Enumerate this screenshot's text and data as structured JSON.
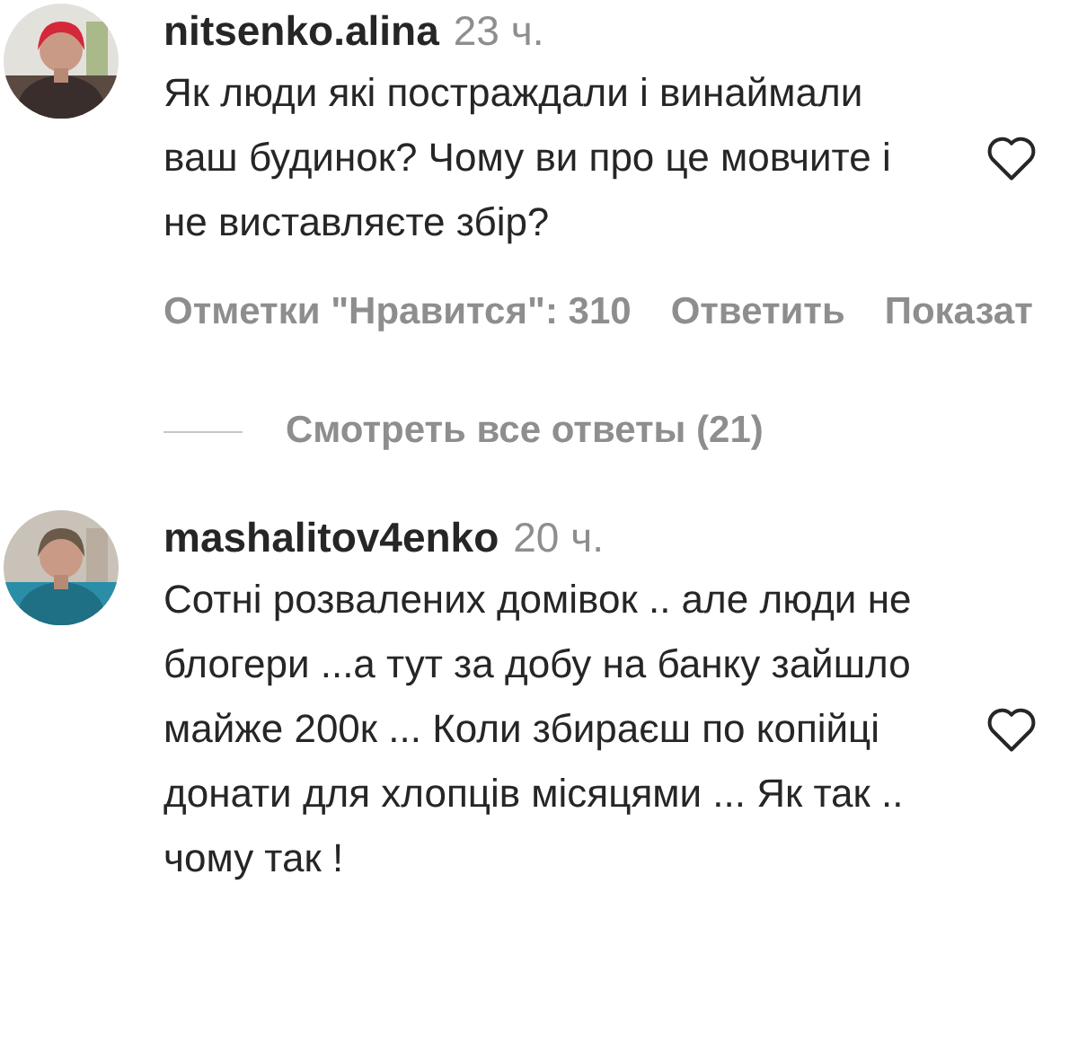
{
  "comments": [
    {
      "username": "nitsenko.alina",
      "time": "23 ч.",
      "text": "Як люди які постраждали і винаймали ваш будинок? Чому ви про це мовчите і не виставляєте збір?",
      "liked": false,
      "actions": [
        "Отметки \"Нравится\": 310",
        "Ответить",
        "Показат"
      ],
      "replies_link": "Смотреть все ответы (21)"
    },
    {
      "username": "mashalitov4enko",
      "time": "20 ч.",
      "text": "Сотні розвалених домівок .. але люди не блогери ...а тут за добу на банку зайшло майже 200к ... Коли збираєш по копійці донати для хлопців місяцями ... Як так .. чому так !",
      "liked": false
    }
  ]
}
